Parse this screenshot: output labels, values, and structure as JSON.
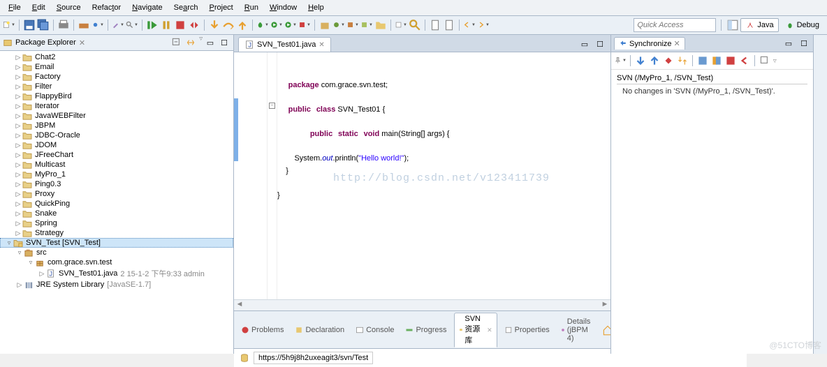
{
  "menu": {
    "items": [
      "File",
      "Edit",
      "Source",
      "Refactor",
      "Navigate",
      "Search",
      "Project",
      "Run",
      "Window",
      "Help"
    ]
  },
  "quick_access": {
    "placeholder": "Quick Access"
  },
  "perspectives": {
    "java": "Java",
    "debug": "Debug"
  },
  "package_explorer": {
    "title": "Package Explorer",
    "projects": [
      "Chat2",
      "Email",
      "Factory",
      "Filter",
      "FlappyBird",
      "Iterator",
      "JavaWEBFilter",
      "JBPM",
      "JDBC-Oracle",
      "JDOM",
      "JFreeChart",
      "Multicast",
      "MyPro_1",
      "Ping0.3",
      "Proxy",
      "QuickPing",
      "Snake",
      "Spring",
      "Strategy"
    ],
    "svn_project": {
      "label": "SVN_Test [SVN_Test]"
    },
    "src": {
      "label": "src"
    },
    "pkg": {
      "label": "com.grace.svn.test"
    },
    "java_file": {
      "name": "SVN_Test01.java",
      "rev": "2",
      "date": "15-1-2 下午9:33",
      "author": "admin"
    },
    "jre": {
      "label": "JRE System Library",
      "decor": "[JavaSE-1.7]"
    }
  },
  "editor": {
    "tab": "SVN_Test01.java",
    "code": {
      "pkg_kw": "package",
      "pkg_val": " com.grace.svn.test;",
      "pub": "public",
      "cls": "class",
      "cls_name": " SVN_Test01 {",
      "stat": "static",
      "vd": "void",
      "main_sig": " main(String[] args) {",
      "sys": "        System.",
      "out": "out",
      "println": ".println(",
      "hello": "\"Hello world!\"",
      "end": ");",
      "cb1": "    }",
      "cb2": "}"
    },
    "watermark": "http://blog.csdn.net/v123411739"
  },
  "synchronize": {
    "title": "Synchronize",
    "header": "SVN (/MyPro_1, /SVN_Test)",
    "message": "No changes in 'SVN (/MyPro_1, /SVN_Test)'."
  },
  "bottom": {
    "tabs": {
      "problems": "Problems",
      "declaration": "Declaration",
      "console": "Console",
      "progress": "Progress",
      "svn": "SVN 资源库",
      "properties": "Properties",
      "details": "Details (jBPM 4)"
    },
    "url": "https://5h9j8h2uxeagit3/svn/Test"
  },
  "blog_tag": "@51CTO博客"
}
